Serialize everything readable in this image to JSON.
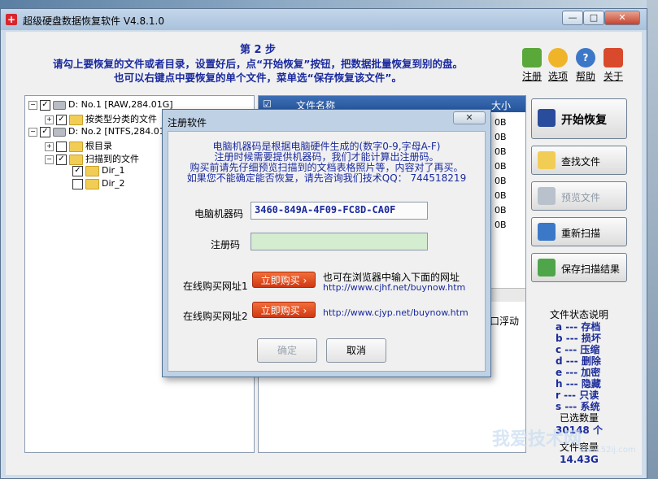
{
  "window": {
    "title": "超级硬盘数据恢复软件 V4.8.1.0",
    "controls": {
      "min": "—",
      "max": "□",
      "close": "✕"
    }
  },
  "step": {
    "line1": "第 2 步",
    "line2": "请勾上要恢复的文件或者目录，设置好后，点“开始恢复”按钮，把数据批量恢复到别的盘。",
    "line3": "也可以右键点中要恢复的单个文件，菜单选“保存恢复该文件”。"
  },
  "toolbar": [
    {
      "icon": "cart-icon",
      "label": "注册",
      "color": "#5aa83a"
    },
    {
      "icon": "gear-icon",
      "label": "选项",
      "color": "#f0b429"
    },
    {
      "icon": "help-icon",
      "label": "帮助",
      "color": "#3c78c8"
    },
    {
      "icon": "home-icon",
      "label": "关于",
      "color": "#d9492c"
    }
  ],
  "tree": [
    {
      "label": "D: No.1 [RAW,284.01G]",
      "checked": true,
      "kind": "drive"
    },
    {
      "label": "按类型分类的文件",
      "checked": true,
      "kind": "folder"
    },
    {
      "label": "D: No.2 [NTFS,284.01G]",
      "checked": true,
      "kind": "drive"
    },
    {
      "label": "根目录",
      "checked": false,
      "kind": "folder"
    },
    {
      "label": "扫描到的文件",
      "checked": true,
      "kind": "folder"
    },
    {
      "label": "Dir_1",
      "checked": true,
      "kind": "folder"
    },
    {
      "label": "Dir_2",
      "checked": false,
      "kind": "folder"
    }
  ],
  "filelist": {
    "columns": {
      "name": "文件名称",
      "size": "大小"
    },
    "sizes": [
      "0B",
      "0B",
      "0B",
      "0B",
      "0B",
      "0B",
      "0B",
      "0B"
    ],
    "float_label": "口浮动"
  },
  "actions": {
    "start": "开始恢复",
    "find": "查找文件",
    "preview": "预览文件",
    "rescan": "重新扫描",
    "save": "保存扫描结果"
  },
  "legend": {
    "title": "文件状态说明",
    "items": [
      "a --- 存档",
      "b --- 损坏",
      "c --- 压缩",
      "d --- 删除",
      "e --- 加密",
      "h --- 隐藏",
      "r --- 只读",
      "s --- 系统"
    ],
    "selected_label": "已选数量",
    "selected_value": "30148 个",
    "capacity_label": "文件容量",
    "capacity_value": "14.43G"
  },
  "dialog": {
    "title": "注册软件",
    "close": "✕",
    "info": [
      "电脑机器码是根据电脑硬件生成的(数字0-9,字母A-F)",
      "注册时候需要提供机器码，我们才能计算出注册码。",
      "购买前请先仔细预览扫描到的文档表格照片等，内容对了再买。",
      "如果您不能确定能否恢复，请先咨询我们技术QQ：  744518219"
    ],
    "machine_label": "电脑机器码",
    "machine_code": "3460-849A-4F09-FC8D-CA0F",
    "reg_label": "注册码",
    "reg_value": "",
    "buy1_label": "在线购买网址1",
    "buy2_label": "在线购买网址2",
    "buy_button": "立即购买",
    "buy1_hint": "也可在浏览器中输入下面的网址",
    "buy1_url": "http://www.cjhf.net/buynow.htm",
    "buy2_url": "http://www.cjyp.net/buynow.htm",
    "ok": "确定",
    "cancel": "取消"
  },
  "watermark": {
    "text": "我爱技术网",
    "sub": "www.52ij.com"
  }
}
